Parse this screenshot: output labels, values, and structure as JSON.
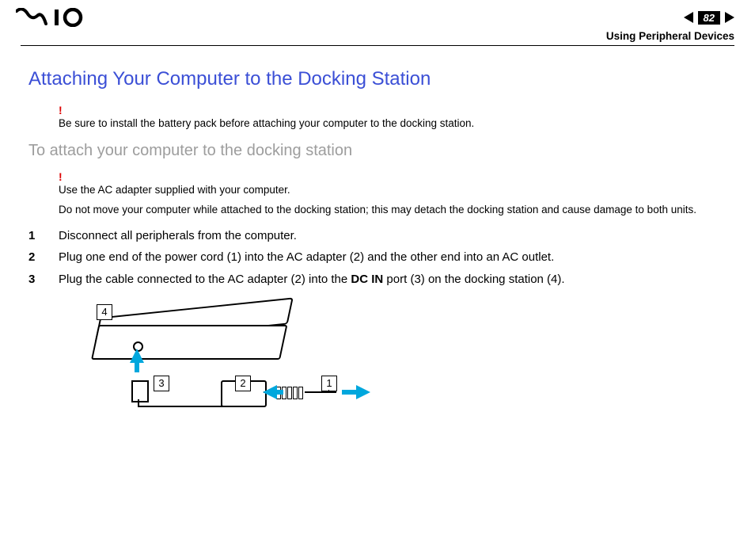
{
  "header": {
    "page_number": "82",
    "section_label": "Using Peripheral Devices"
  },
  "title": "Attaching Your Computer to the Docking Station",
  "caution1": "Be sure to install the battery pack before attaching your computer to the docking station.",
  "subhead": "To attach your computer to the docking station",
  "caution2_line1": "Use the AC adapter supplied with your computer.",
  "caution2_line2": "Do not move your computer while attached to the docking station; this may detach the docking station and cause damage to both units.",
  "steps": [
    "Disconnect all peripherals from the computer.",
    "Plug one end of the power cord (1) into the AC adapter (2) and the other end into an AC outlet.",
    "Plug the cable connected to the AC adapter (2) into the DC IN port (3) on the docking station (4)."
  ],
  "step3_parts": {
    "prefix": "Plug the cable connected to the AC adapter (2) into the ",
    "bold": "DC IN",
    "suffix": " port (3) on the docking station (4)."
  },
  "callouts": {
    "c1": "1",
    "c2": "2",
    "c3": "3",
    "c4": "4"
  },
  "caution_mark": "!"
}
